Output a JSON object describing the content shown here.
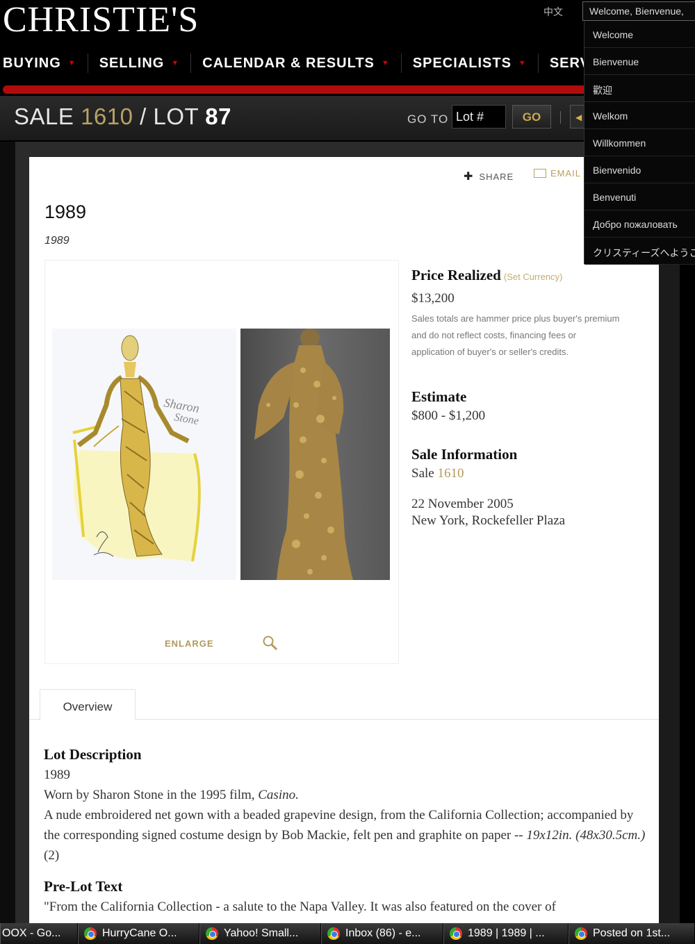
{
  "header": {
    "logo": "CHRISTIE'S",
    "lang_link": "中文",
    "welcome_select": "Welcome, Bienvenue,",
    "nav": [
      {
        "label": "BUYING",
        "caret": true
      },
      {
        "label": "SELLING",
        "caret": true
      },
      {
        "label": "CALENDAR & RESULTS",
        "caret": true
      },
      {
        "label": "SPECIALISTS",
        "caret": true
      },
      {
        "label": "SERVIC",
        "caret": false
      }
    ]
  },
  "salebar": {
    "sale_word": "SALE",
    "sale_number": "1610",
    "slash": "/",
    "lot_word": "LOT",
    "lot_number": "87",
    "goto_label": "GO TO",
    "lot_input_placeholder": "Lot #",
    "go_label": "GO"
  },
  "dropdown": {
    "items": [
      "Welcome",
      "Bienvenue",
      "歡迎",
      "Welkom",
      "Willkommen",
      "Bienvenido",
      "Benvenuti",
      "Добро пожаловать",
      "クリスティーズへようこ"
    ]
  },
  "lot": {
    "share_label": "SHARE",
    "email_label": "EMAIL",
    "title": "1989",
    "subtitle": "1989",
    "enlarge_label": "ENLARGE",
    "sketch_signature": "Sharon Stone"
  },
  "info": {
    "price_heading": "Price Realized",
    "set_currency": "(Set Currency)",
    "price": "$13,200",
    "price_note": "Sales totals are hammer price plus buyer's premium and do not reflect costs, financing fees or application of buyer's or seller's credits.",
    "estimate_heading": "Estimate",
    "estimate": "$800 - $1,200",
    "sale_info_heading": "Sale Information",
    "sale_word": "Sale",
    "sale_number": "1610",
    "date": "22 November 2005",
    "location": "New York, Rockefeller Plaza"
  },
  "tabs": {
    "overview": "Overview"
  },
  "description": {
    "heading": "Lot Description",
    "line1": "1989",
    "line2_prefix": "Worn by Sharon Stone in the 1995 film,",
    "line2_film": "Casino.",
    "line3": "A nude embroidered net gown with a beaded grapevine design, from the California Collection; accompanied by the corresponding signed costume design by Bob Mackie, felt pen and graphite on paper --",
    "line3_dims": "19x12in. (48x30.5cm.)",
    "line3_count": "(2)",
    "prelot_heading": "Pre-Lot Text",
    "prelot_text": "\"From the California Collection - a salute to the Napa Valley. It was also featured on the cover of"
  },
  "taskbar": {
    "items": [
      "OOX - Go...",
      "HurryCane O...",
      "Yahoo! Small...",
      "Inbox (86) - e...",
      "1989 | 1989 | ...",
      "Posted on 1st..."
    ]
  },
  "colors": {
    "gold": "#b8a267",
    "red_bar": "#b20b0b"
  }
}
